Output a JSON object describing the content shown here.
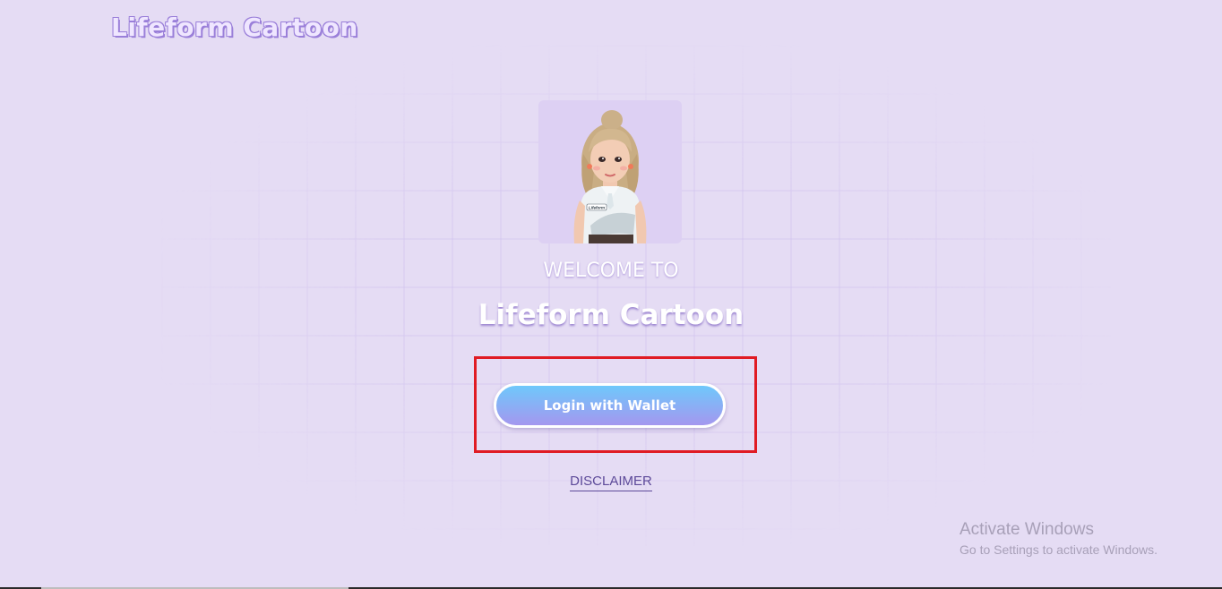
{
  "header": {
    "brand": "Lifeform Cartoon"
  },
  "hero": {
    "avatar_icon": "female-avatar-icon",
    "avatar_shirt_text": "Lifeform",
    "welcome": "WELCOME TO",
    "title": "Lifeform Cartoon",
    "login_label": "Login with Wallet",
    "disclaimer_label": "DISCLAIMER"
  },
  "os_watermark": {
    "line1": "Activate Windows",
    "line2": "Go to Settings to activate Windows."
  },
  "colors": {
    "background": "#e5dcf4",
    "button_gradient_start": "#6fc8fb",
    "button_gradient_end": "#a497ef",
    "highlight": "#e01b24",
    "disclaimer": "#5d4a99"
  }
}
